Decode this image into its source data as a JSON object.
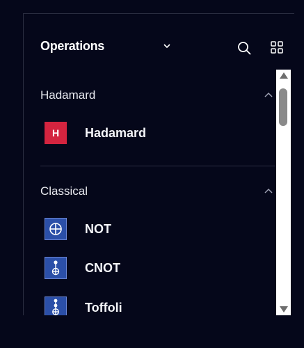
{
  "panel": {
    "title": "Operations",
    "title_chevron_icon": "chevron-down-icon",
    "search_icon": "search-icon",
    "grid_view_icon": "grid-icon"
  },
  "sections": [
    {
      "label": "Hadamard",
      "chevron_icon": "chevron-up-icon",
      "items": [
        {
          "label": "Hadamard",
          "icon_text": "H",
          "icon_color": "#d4243f"
        }
      ]
    },
    {
      "label": "Classical",
      "chevron_icon": "chevron-up-icon",
      "items": [
        {
          "label": "NOT",
          "icon": "not-gate-icon",
          "icon_color": "#2b4fa8"
        },
        {
          "label": "CNOT",
          "icon": "cnot-gate-icon",
          "icon_color": "#2b4fa8"
        },
        {
          "label": "Toffoli",
          "icon": "toffoli-gate-icon",
          "icon_color": "#2b4fa8"
        }
      ]
    }
  ],
  "colors": {
    "background": "#05071a",
    "hadamard_red": "#d4243f",
    "classical_blue": "#2b4fa8"
  }
}
